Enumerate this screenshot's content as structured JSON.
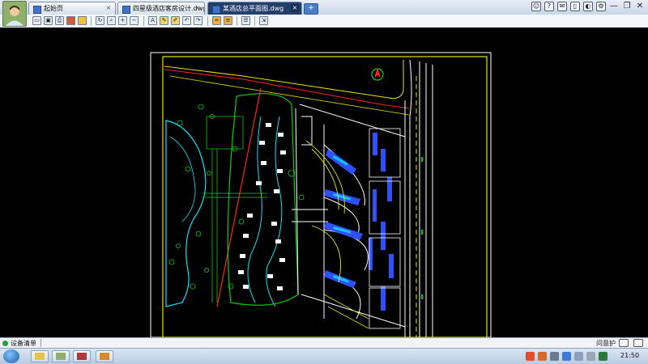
{
  "tabs": [
    {
      "label": "起始页",
      "active": false
    },
    {
      "label": "四星级酒店客房设计.dwg",
      "active": false
    },
    {
      "label": "某酒店总平面图.dwg",
      "active": true
    }
  ],
  "new_tab_label": "+",
  "toolbar": {
    "icons": [
      "open-icon",
      "save-icon",
      "print-icon",
      "export-icon",
      "lock-icon",
      "refresh-icon",
      "zoom-window-icon",
      "zoom-in-icon",
      "zoom-out-icon",
      "text-icon",
      "pencil-icon",
      "marker-icon",
      "undo-icon",
      "redo-icon",
      "measure-icon",
      "layer-icon",
      "layer-stack-icon",
      "export-doc-icon"
    ]
  },
  "topbar_icons": [
    "user-icon",
    "help-icon",
    "message-icon",
    "phone-icon",
    "skin-icon",
    "settings-icon"
  ],
  "status": {
    "label": "设备清单",
    "feedback": "问意护"
  },
  "taskbar": {
    "time": "21:50"
  },
  "colors": {
    "cad_yellow": "#e6e600",
    "cad_red": "#ff2020",
    "cad_cyan": "#00e5ff",
    "cad_green": "#00d000",
    "cad_blue": "#3050ff",
    "cad_white": "#ffffff"
  }
}
